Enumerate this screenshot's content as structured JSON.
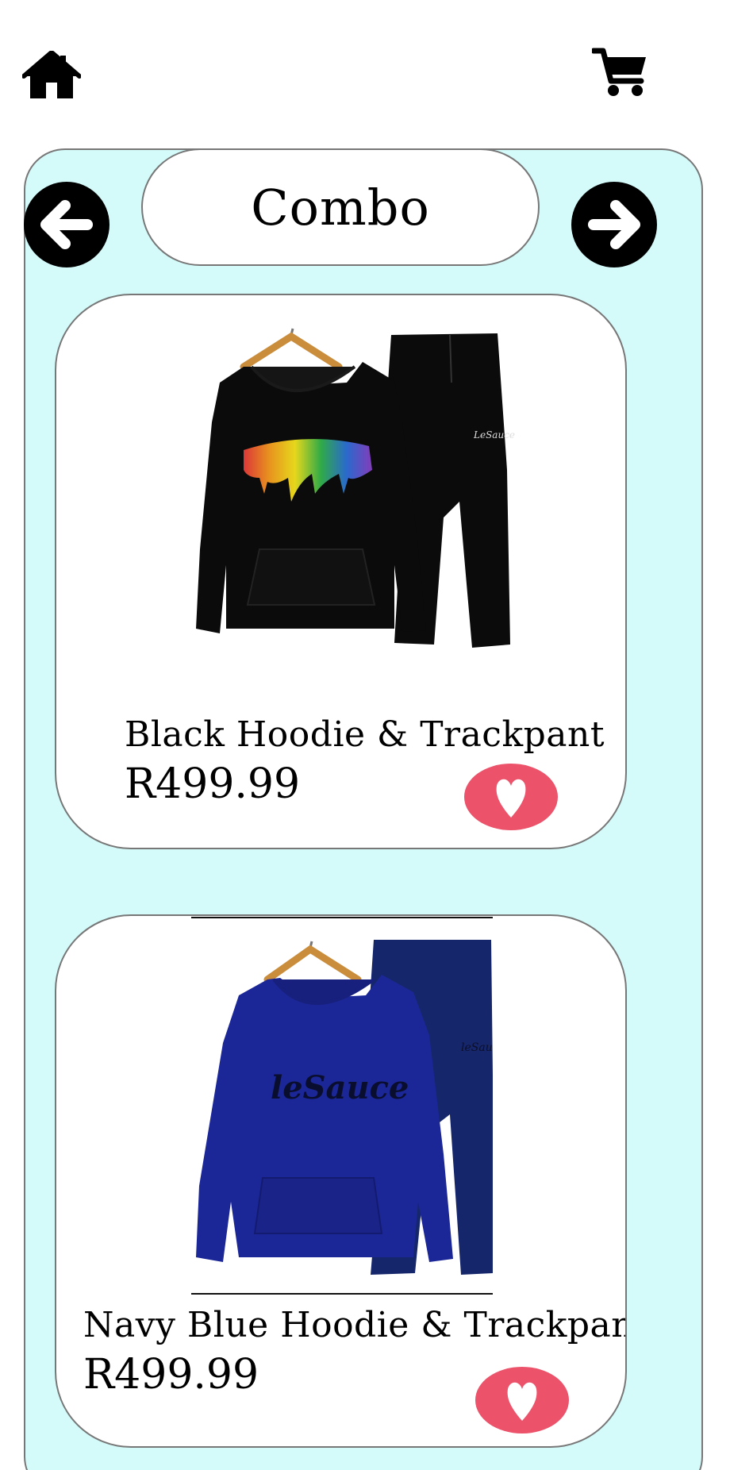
{
  "header": {
    "home_icon": "home-icon",
    "cart_icon": "shopping-cart-icon"
  },
  "category": {
    "title": "Combo",
    "prev_icon": "arrow-left-icon",
    "next_icon": "arrow-right-icon",
    "panel_color": "#d4fbfa"
  },
  "products": [
    {
      "name": "Black Hoodie & Trackpant",
      "price": "R499.99",
      "color": "#0b0b0b",
      "favorite_icon": "heart-icon"
    },
    {
      "name": "Navy Blue Hoodie & Trackpant",
      "price": "R499.99",
      "color": "#1c2797",
      "favorite_icon": "heart-icon"
    }
  ],
  "colors": {
    "favorite_button": "#ec536b"
  }
}
